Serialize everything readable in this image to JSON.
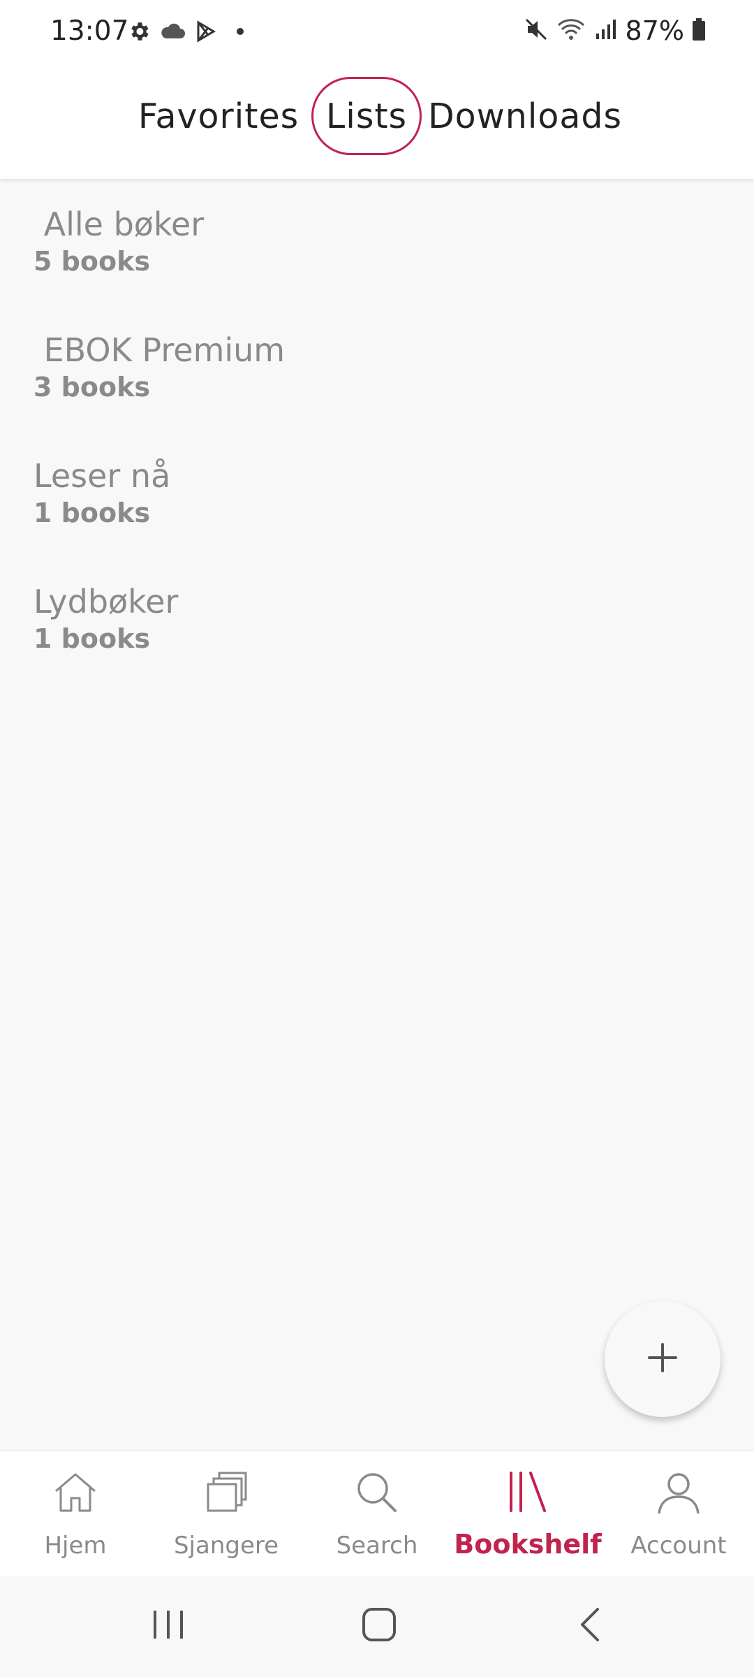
{
  "status_bar": {
    "time": "13:07",
    "battery": "87%",
    "left_icons": [
      "gear-icon",
      "cloud-icon",
      "play-store-icon",
      "dot-icon"
    ],
    "right_icons": [
      "mute-icon",
      "wifi-icon",
      "signal-icon",
      "battery-icon"
    ]
  },
  "tabs": {
    "favorites": "Favorites",
    "lists": "Lists",
    "downloads": "Downloads",
    "selected": "Lists"
  },
  "lists": [
    {
      "name": " Alle bøker",
      "count": "5 books"
    },
    {
      "name": " EBOK Premium",
      "count": "3 books"
    },
    {
      "name": "Leser nå",
      "count": "1 books"
    },
    {
      "name": "Lydbøker",
      "count": "1 books"
    }
  ],
  "fab": {
    "icon": "plus-icon"
  },
  "bottom_nav": {
    "items": [
      {
        "label": "Hjem",
        "icon": "home-icon"
      },
      {
        "label": "Sjangere",
        "icon": "genres-icon"
      },
      {
        "label": "Search",
        "icon": "search-icon"
      },
      {
        "label": "Bookshelf",
        "icon": "bookshelf-icon"
      },
      {
        "label": "Account",
        "icon": "account-icon"
      }
    ],
    "active": "Bookshelf"
  },
  "colors": {
    "accent": "#c0234e",
    "muted_text": "#8a8a8a",
    "background": "#f8f8f8"
  }
}
